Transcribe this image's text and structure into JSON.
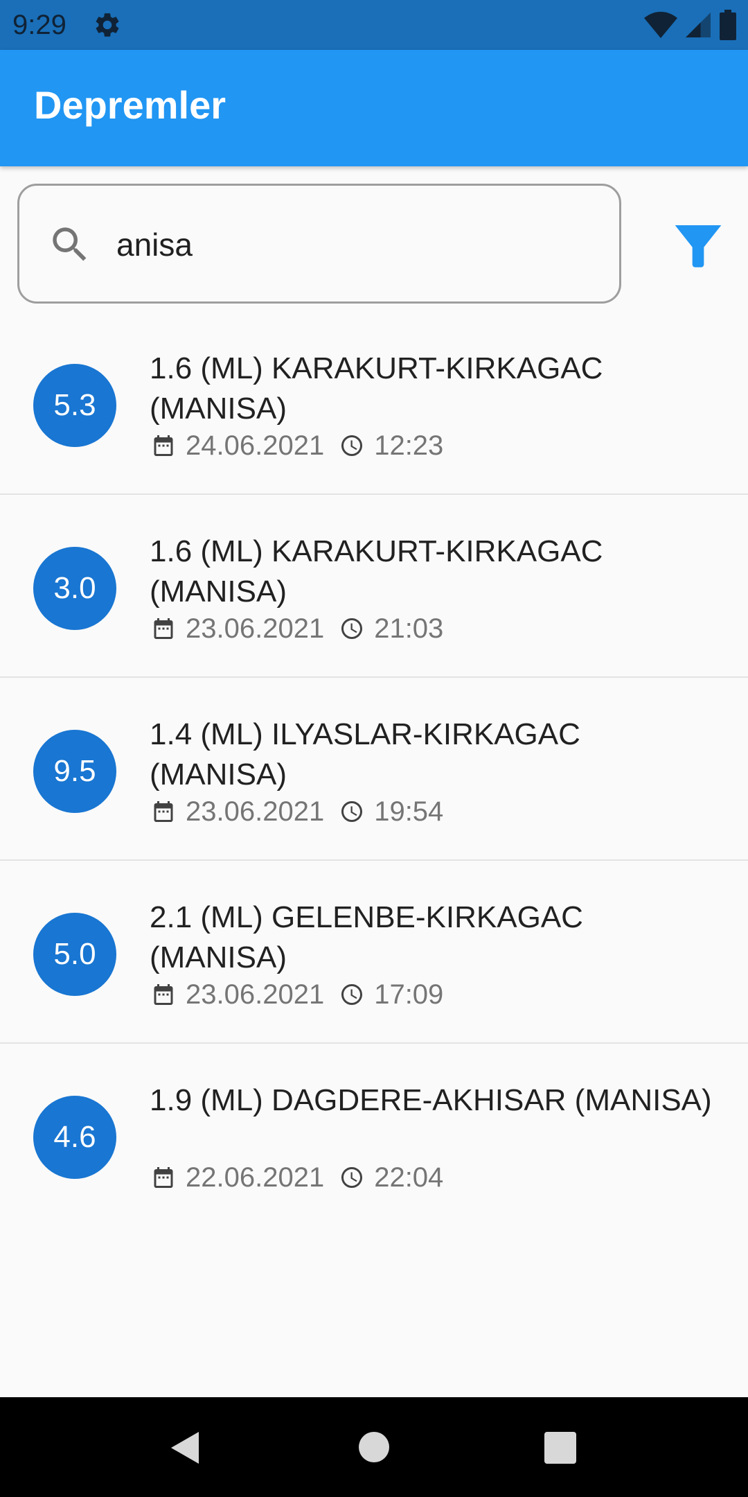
{
  "status_bar": {
    "time": "9:29",
    "icons": [
      "settings-icon",
      "wifi-icon",
      "cellular-signal-icon",
      "battery-icon"
    ]
  },
  "app_bar": {
    "title": "Depremler"
  },
  "search": {
    "value": "anisa",
    "icon": "search-icon"
  },
  "filter": {
    "icon": "filter-icon",
    "color": "#2196f3"
  },
  "colors": {
    "primary": "#2196f3",
    "status_bar": "#1a6fb8",
    "badge": "#1976d2"
  },
  "earthquakes": [
    {
      "magnitude": "5.3",
      "title": "1.6 (ML) KARAKURT-KIRKAGAC (MANISA)",
      "date": "24.06.2021",
      "time": "12:23"
    },
    {
      "magnitude": "3.0",
      "title": "1.6 (ML) KARAKURT-KIRKAGAC (MANISA)",
      "date": "23.06.2021",
      "time": "21:03"
    },
    {
      "magnitude": "9.5",
      "title": "1.4 (ML) ILYASLAR-KIRKAGAC (MANISA)",
      "date": "23.06.2021",
      "time": "19:54"
    },
    {
      "magnitude": "5.0",
      "title": "2.1 (ML) GELENBE-KIRKAGAC (MANISA)",
      "date": "23.06.2021",
      "time": "17:09"
    },
    {
      "magnitude": "4.6",
      "title": "1.9 (ML) DAGDERE-AKHISAR (MANISA)",
      "date": "22.06.2021",
      "time": "22:04"
    }
  ],
  "nav_bar": {
    "icons": [
      "back-icon",
      "home-icon",
      "recents-icon"
    ]
  }
}
